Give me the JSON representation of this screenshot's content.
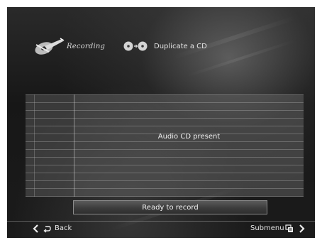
{
  "header": {
    "section_label": "Recording",
    "section_icon": "recording-cd-icon",
    "task_icon": "cd-to-cd-icon",
    "task_label": "Duplicate a CD"
  },
  "panel": {
    "message": "Audio CD present"
  },
  "status": {
    "text": "Ready to record"
  },
  "footer": {
    "back_label": "Back",
    "back_icon": "return-arrow-icon",
    "submenu_label": "Submenu",
    "submenu_icon": "submenu-icon"
  },
  "colors": {
    "background": "#1b1b1b",
    "text": "#f0f0f0",
    "panel": "#5a5a5a"
  }
}
